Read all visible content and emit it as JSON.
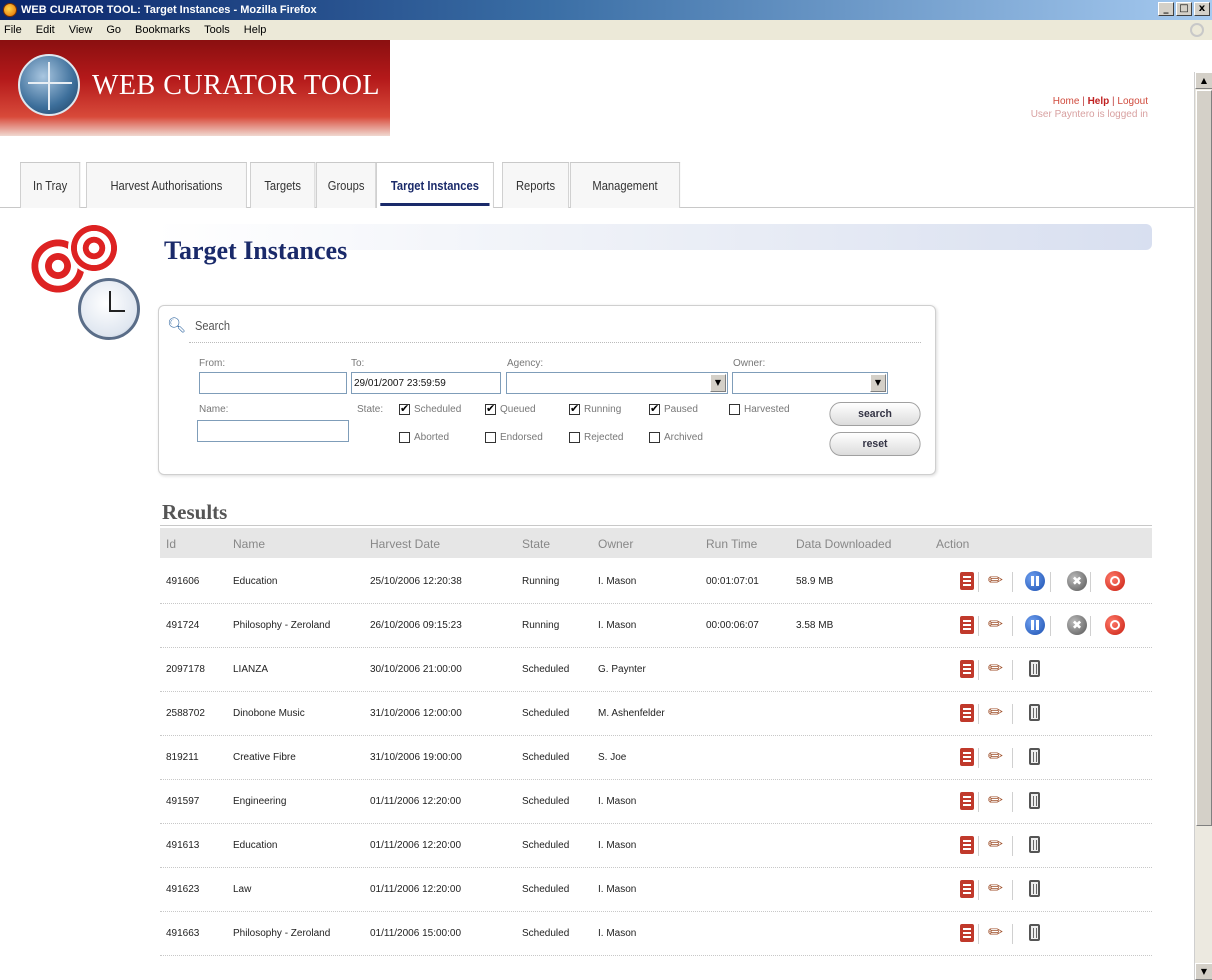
{
  "window": {
    "title": "WEB CURATOR TOOL: Target Instances - Mozilla Firefox",
    "min": "_",
    "max": "□",
    "close": "x"
  },
  "menu": [
    "File",
    "Edit",
    "View",
    "Go",
    "Bookmarks",
    "Tools",
    "Help"
  ],
  "logo": {
    "text": "WEB CURATOR TOOL"
  },
  "toplinks": {
    "home": "Home",
    "sep1": " | ",
    "help": "Help",
    "sep2": " | ",
    "logout": "Logout",
    "logged_in": "User Payntero is logged in"
  },
  "tabs": [
    "In Tray",
    "Harvest Authorisations",
    "Targets",
    "Groups",
    "Target Instances",
    "Reports",
    "Management"
  ],
  "active_tab": "Target Instances",
  "page": {
    "title": "Target Instances"
  },
  "search": {
    "title": "Search",
    "from_label": "From:",
    "from_value": "",
    "to_label": "To:",
    "to_value": "29/01/2007 23:59:59",
    "agency_label": "Agency:",
    "agency_value": "",
    "owner_label": "Owner:",
    "owner_value": "",
    "name_label": "Name:",
    "name_value": "",
    "state_label": "State:",
    "states": [
      {
        "label": "Scheduled",
        "checked": true
      },
      {
        "label": "Queued",
        "checked": true
      },
      {
        "label": "Running",
        "checked": true
      },
      {
        "label": "Paused",
        "checked": true
      },
      {
        "label": "Harvested",
        "checked": false
      },
      {
        "label": "Aborted",
        "checked": false
      },
      {
        "label": "Endorsed",
        "checked": false
      },
      {
        "label": "Rejected",
        "checked": false
      },
      {
        "label": "Archived",
        "checked": false
      }
    ],
    "search_button": "search",
    "reset_button": "reset"
  },
  "results": {
    "title": "Results",
    "columns": [
      "Id",
      "Name",
      "Harvest Date",
      "State",
      "Owner",
      "Run Time",
      "Data Downloaded",
      "Action"
    ],
    "rows": [
      {
        "id": "491606",
        "name": "Education",
        "date": "25/10/2006 12:20:38",
        "state": "Running",
        "owner": "I. Mason",
        "runtime": "00:01:07:01",
        "data": "58.9 MB",
        "actions": [
          "view",
          "edit",
          "pause",
          "stop",
          "abort"
        ]
      },
      {
        "id": "491724",
        "name": "Philosophy - Zeroland",
        "date": "26/10/2006 09:15:23",
        "state": "Running",
        "owner": "I. Mason",
        "runtime": "00:00:06:07",
        "data": "3.58 MB",
        "actions": [
          "view",
          "edit",
          "pause",
          "stop",
          "abort"
        ]
      },
      {
        "id": "2097178",
        "name": "LIANZA",
        "date": "30/10/2006 21:00:00",
        "state": "Scheduled",
        "owner": "G. Paynter",
        "runtime": "",
        "data": "",
        "actions": [
          "view",
          "edit",
          "delete"
        ]
      },
      {
        "id": "2588702",
        "name": "Dinobone Music",
        "date": "31/10/2006 12:00:00",
        "state": "Scheduled",
        "owner": "M. Ashenfelder",
        "runtime": "",
        "data": "",
        "actions": [
          "view",
          "edit",
          "delete"
        ]
      },
      {
        "id": "819211",
        "name": "Creative Fibre",
        "date": "31/10/2006 19:00:00",
        "state": "Scheduled",
        "owner": "S. Joe",
        "runtime": "",
        "data": "",
        "actions": [
          "view",
          "edit",
          "delete"
        ]
      },
      {
        "id": "491597",
        "name": "Engineering",
        "date": "01/11/2006 12:20:00",
        "state": "Scheduled",
        "owner": "I. Mason",
        "runtime": "",
        "data": "",
        "actions": [
          "view",
          "edit",
          "delete"
        ]
      },
      {
        "id": "491613",
        "name": "Education",
        "date": "01/11/2006 12:20:00",
        "state": "Scheduled",
        "owner": "I. Mason",
        "runtime": "",
        "data": "",
        "actions": [
          "view",
          "edit",
          "delete"
        ]
      },
      {
        "id": "491623",
        "name": "Law",
        "date": "01/11/2006 12:20:00",
        "state": "Scheduled",
        "owner": "I. Mason",
        "runtime": "",
        "data": "",
        "actions": [
          "view",
          "edit",
          "delete"
        ]
      },
      {
        "id": "491663",
        "name": "Philosophy - Zeroland",
        "date": "01/11/2006 15:00:00",
        "state": "Scheduled",
        "owner": "I. Mason",
        "runtime": "",
        "data": "",
        "actions": [
          "view",
          "edit",
          "delete"
        ]
      }
    ]
  },
  "colors": {
    "brand_red": "#b4191a",
    "title_blue": "#1a2a6a",
    "header_gray": "#e6e6e6"
  }
}
